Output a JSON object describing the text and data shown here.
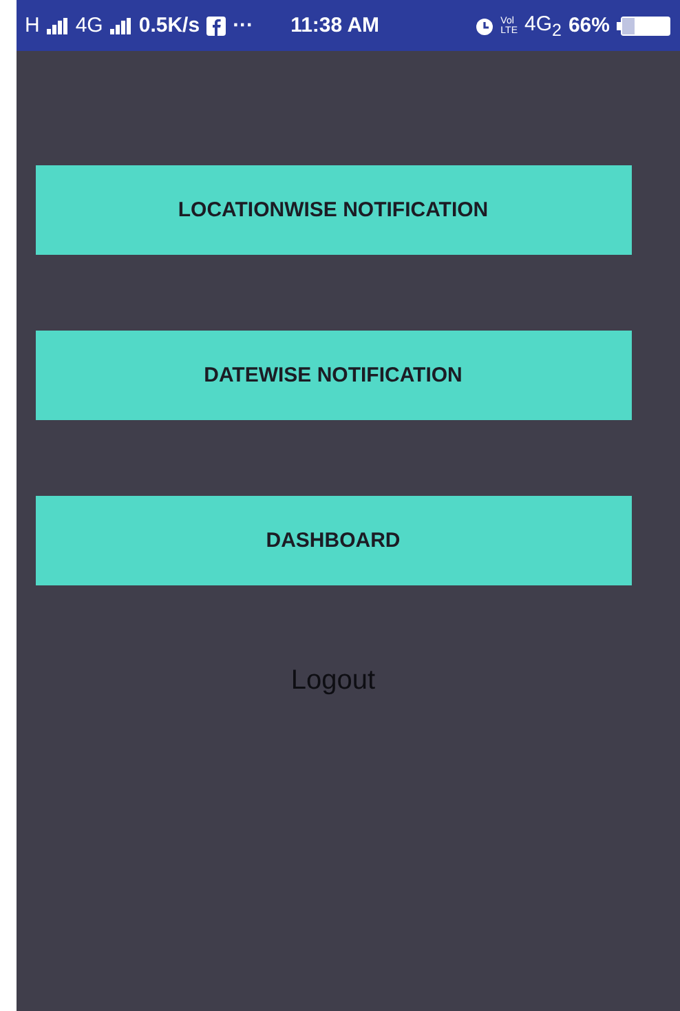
{
  "status_bar": {
    "network": "H",
    "network_2": "4G",
    "speed": "0.5K/s",
    "more": "···",
    "time": "11:38 AM",
    "volte_top": "Vol",
    "volte_bottom": "LTE",
    "network_3": "4G$_{2}$",
    "battery": "66%"
  },
  "menu": {
    "buttons": [
      {
        "label": "LOCATIONWISE NOTIFICATION"
      },
      {
        "label": "DATEWISE NOTIFICATION"
      },
      {
        "label": "DASHBOARD"
      }
    ],
    "logout": "Logout"
  }
}
